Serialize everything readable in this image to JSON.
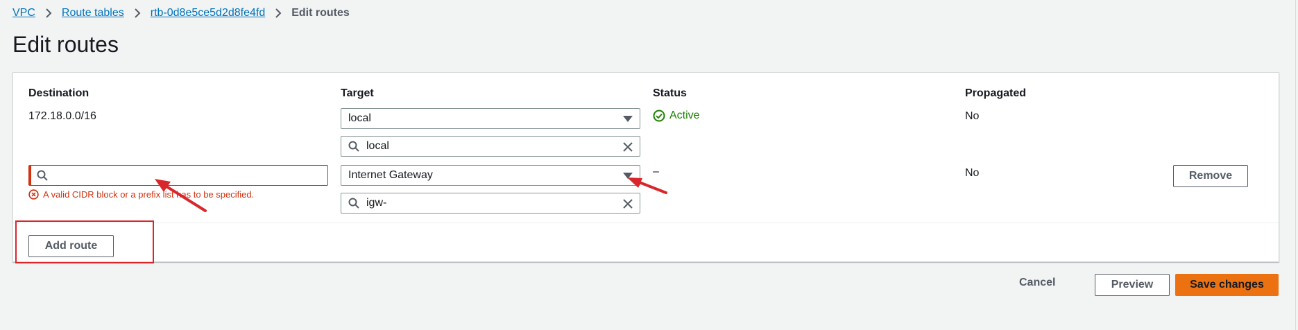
{
  "breadcrumb": {
    "items": [
      "VPC",
      "Route tables",
      "rtb-0d8e5ce5d2d8fe4fd"
    ],
    "current": "Edit routes"
  },
  "page": {
    "title": "Edit routes"
  },
  "table": {
    "headers": {
      "destination": "Destination",
      "target": "Target",
      "status": "Status",
      "propagated": "Propagated"
    },
    "rows": [
      {
        "destination": "172.18.0.0/16",
        "target_selected": "local",
        "target_search": "local",
        "status": "Active",
        "propagated": "No"
      },
      {
        "destination": "",
        "destination_error": "A valid CIDR block or a prefix list has to be specified.",
        "target_selected": "Internet Gateway",
        "target_search": "igw-",
        "status": "–",
        "propagated": "No",
        "remove_label": "Remove"
      }
    ],
    "add_route_label": "Add route"
  },
  "footer": {
    "cancel_label": "Cancel",
    "preview_label": "Preview",
    "save_label": "Save changes"
  },
  "icons": {
    "breadcrumb_separator": "chevron-right-icon",
    "select_caret": "caret-down-icon",
    "search": "search-icon",
    "clear": "close-icon",
    "error": "error-x-icon",
    "status_ok": "check-circle-icon"
  },
  "colors": {
    "link": "#0073bb",
    "error": "#d13212",
    "success": "#1d8102",
    "primary": "#ec7211",
    "annotation": "#d9262b"
  }
}
